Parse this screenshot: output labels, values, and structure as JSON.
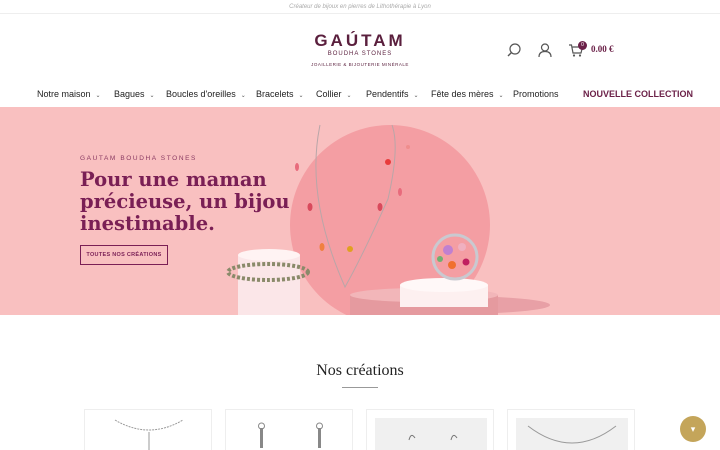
{
  "topbar": {
    "text": "Créateur de bijoux en pierres de Lithothérapie à Lyon"
  },
  "logo": {
    "main": "GAÚTAM",
    "sub": "BOUDHA STONES",
    "tagline": "JOAILLERIE & BIJOUTERIE MINÉRALE"
  },
  "header": {
    "icons": [
      "search-icon",
      "user-icon",
      "cart-icon"
    ],
    "cart_count": "0",
    "cart_amount": "0.00 €"
  },
  "nav": {
    "items": [
      {
        "label": "Notre maison",
        "chevron": "⌄"
      },
      {
        "label": "Bagues",
        "chevron": "⌄"
      },
      {
        "label": "Boucles d'oreilles",
        "chevron": "⌄"
      },
      {
        "label": "Bracelets",
        "chevron": "⌄"
      },
      {
        "label": "Collier",
        "chevron": "⌄"
      },
      {
        "label": "Pendentifs",
        "chevron": "⌄"
      },
      {
        "label": "Fête des mères",
        "chevron": "⌄"
      },
      {
        "label": "Promotions"
      },
      {
        "label": "NOUVELLE COLLECTION"
      }
    ]
  },
  "hero": {
    "brand": "GAUTAM BOUDHA STONES",
    "title": "Pour une maman précieuse, un bijou inestimable.",
    "button": "TOUTES NOS CRÉATIONS"
  },
  "section": {
    "title": "Nos créations"
  },
  "colors": {
    "brand": "#6b2148",
    "hero_bg": "#f9c0c0",
    "accent_gold": "#c4a55a"
  },
  "fab": {
    "icon": "chevron-down-icon",
    "glyph": "▾"
  }
}
